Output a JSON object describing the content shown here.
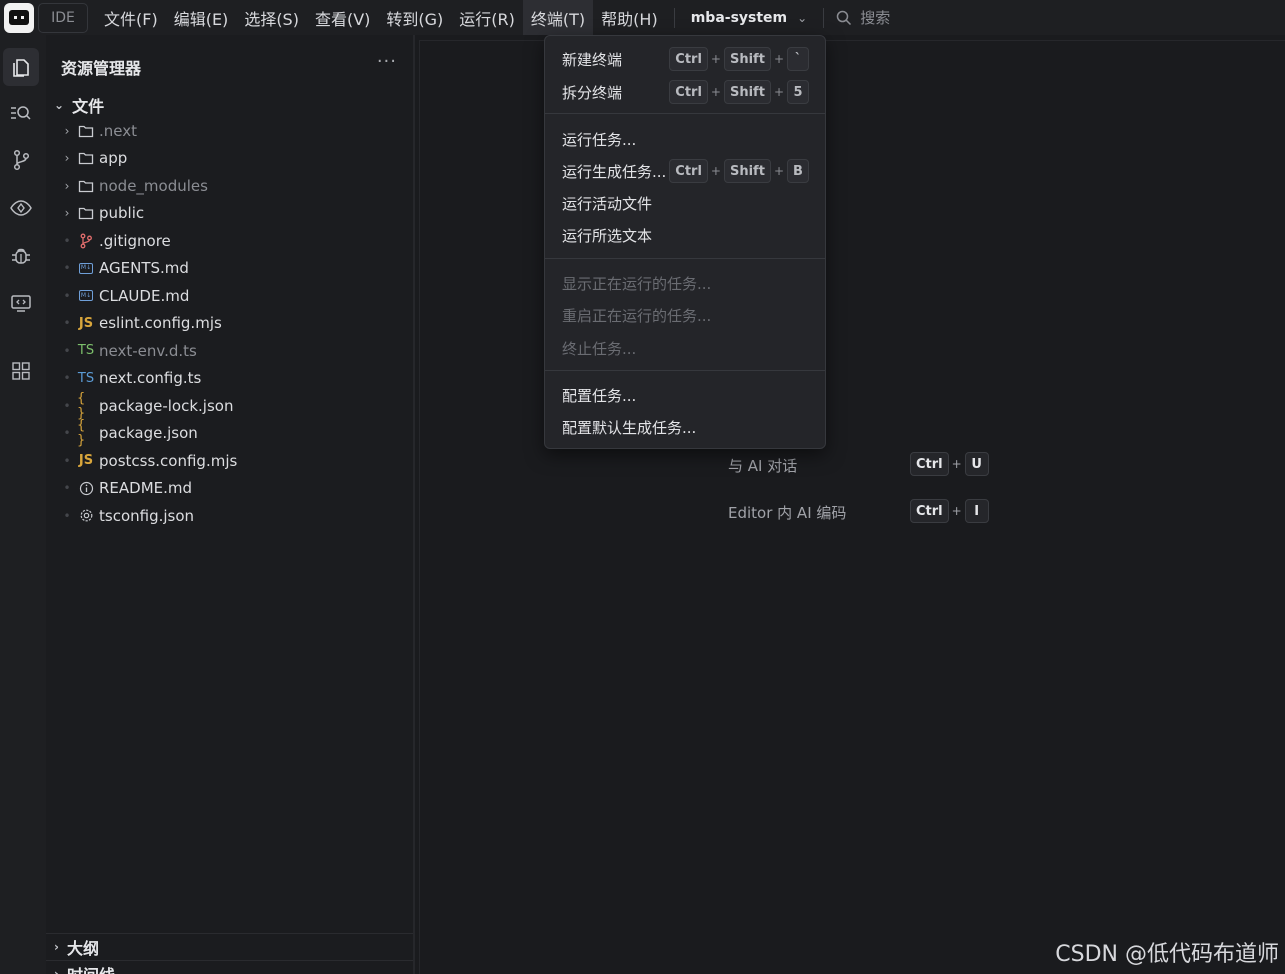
{
  "menubar": {
    "ide_label": "IDE",
    "menus": [
      "文件(F)",
      "编辑(E)",
      "选择(S)",
      "查看(V)",
      "转到(G)",
      "运行(R)",
      "终端(T)",
      "帮助(H)"
    ],
    "project": "mba-system",
    "search_placeholder": "搜索"
  },
  "sidebar": {
    "title": "资源管理器",
    "more": "···",
    "section": "文件",
    "items": [
      {
        "name": ".next",
        "type": "folder",
        "dim": true
      },
      {
        "name": "app",
        "type": "folder",
        "dim": false
      },
      {
        "name": "node_modules",
        "type": "folder",
        "dim": true
      },
      {
        "name": "public",
        "type": "folder",
        "dim": false
      },
      {
        "name": ".gitignore",
        "type": "git",
        "dim": false
      },
      {
        "name": "AGENTS.md",
        "type": "md",
        "dim": false
      },
      {
        "name": "CLAUDE.md",
        "type": "md",
        "dim": false
      },
      {
        "name": "eslint.config.mjs",
        "type": "js",
        "dim": false
      },
      {
        "name": "next-env.d.ts",
        "type": "ts-green",
        "dim": true
      },
      {
        "name": "next.config.ts",
        "type": "ts",
        "dim": false
      },
      {
        "name": "package-lock.json",
        "type": "json",
        "dim": false
      },
      {
        "name": "package.json",
        "type": "json",
        "dim": false
      },
      {
        "name": "postcss.config.mjs",
        "type": "js",
        "dim": false
      },
      {
        "name": "README.md",
        "type": "info",
        "dim": false
      },
      {
        "name": "tsconfig.json",
        "type": "gear",
        "dim": false
      }
    ],
    "outline_label": "大纲",
    "timeline_label": "时间线"
  },
  "terminal_menu": {
    "items": [
      {
        "label": "新建终端",
        "keys": [
          "Ctrl",
          "Shift",
          "`"
        ]
      },
      {
        "label": "拆分终端",
        "keys": [
          "Ctrl",
          "Shift",
          "5"
        ]
      },
      {
        "label": "运行任务...",
        "keys": []
      },
      {
        "label": "运行生成任务...",
        "keys": [
          "Ctrl",
          "Shift",
          "B"
        ]
      },
      {
        "label": "运行活动文件",
        "keys": []
      },
      {
        "label": "运行所选文本",
        "keys": []
      },
      {
        "label": "显示正在运行的任务...",
        "keys": [],
        "disabled": true
      },
      {
        "label": "重启正在运行的任务...",
        "keys": [],
        "disabled": true
      },
      {
        "label": "终止任务...",
        "keys": [],
        "disabled": true
      },
      {
        "label": "配置任务...",
        "keys": []
      },
      {
        "label": "配置默认生成任务...",
        "keys": []
      }
    ]
  },
  "editor": {
    "hints": [
      {
        "label": "与 AI 对话",
        "keys": [
          "Ctrl",
          "U"
        ]
      },
      {
        "label": "Editor 内 AI 编码",
        "keys": [
          "Ctrl",
          "I"
        ]
      }
    ]
  },
  "watermark": "CSDN @低代码布道师",
  "colors": {
    "background": "#1a1b1e",
    "menu_bg": "#242529",
    "accent_folder": "#c9cbd0"
  }
}
